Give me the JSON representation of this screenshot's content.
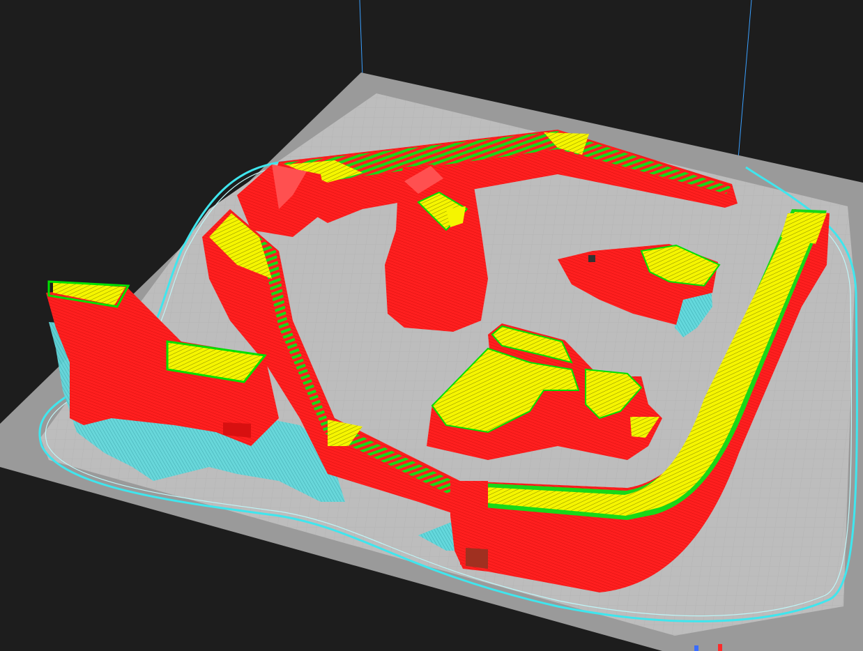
{
  "viewer": {
    "background_color": "#1d1d1d",
    "bed": {
      "outer_color": "#9a9a9a",
      "inner_color": "#bdbdbd",
      "grid_color": "#aeaeae"
    },
    "colors": {
      "perimeter": "#ff1f1f",
      "external_perimeter": "#00ff00",
      "solid_infill": "#f5f500",
      "gap_fill": "#ffffff",
      "support": "#64d8dc",
      "skirt": "#3fe6ee",
      "axis_line": "#3aa0ff"
    },
    "icons": {
      "axis_x": "axis-x-icon",
      "axis_y": "axis-y-icon"
    }
  }
}
